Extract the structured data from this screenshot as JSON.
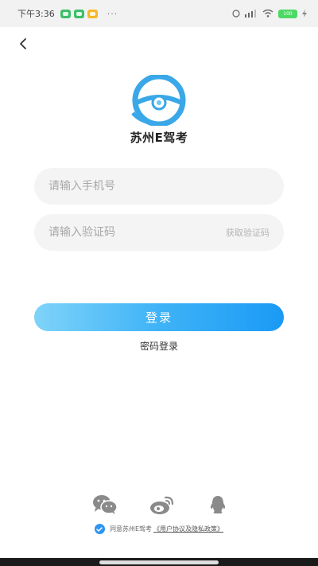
{
  "status_bar": {
    "time": "下午3:36",
    "dots": "···",
    "battery": "100"
  },
  "app": {
    "name": "苏州E驾考"
  },
  "form": {
    "phone_placeholder": "请输入手机号",
    "code_placeholder": "请输入验证码",
    "get_code_label": "获取验证码",
    "login_label": "登录",
    "password_login_label": "密码登录"
  },
  "social": [
    "wechat-icon",
    "weibo-icon",
    "qq-icon"
  ],
  "agreement": {
    "text": "同意苏州E驾考",
    "link": "《用户协议及隐私政策》"
  },
  "colors": {
    "primary": "#1a9af5",
    "logo": "#3aa8e8"
  }
}
